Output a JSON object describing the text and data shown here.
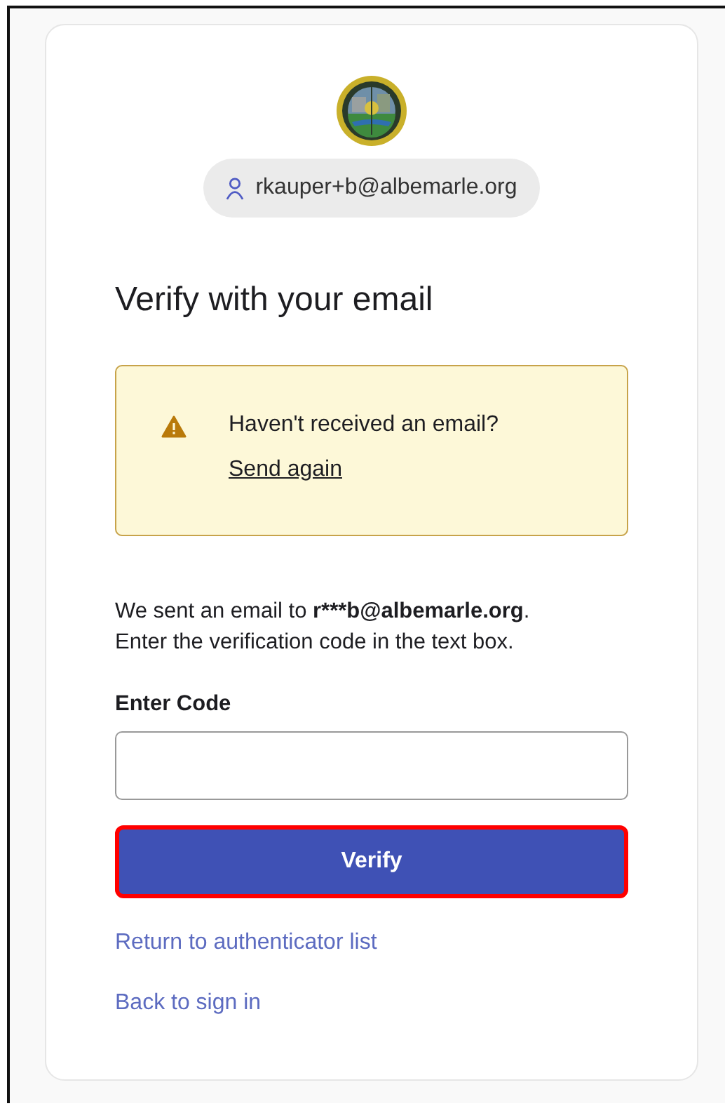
{
  "identity": {
    "email": "rkauper+b@albemarle.org"
  },
  "title": "Verify with your email",
  "alert": {
    "message": "Haven't received an email?",
    "link": "Send again"
  },
  "instructions": {
    "before": "We sent an email to ",
    "email": "r***b@albemarle.org",
    "after": ".\nEnter the verification code in the text box."
  },
  "code_field": {
    "label": "Enter Code"
  },
  "verify_button": {
    "label": "Verify",
    "highlighted": true
  },
  "links": [
    "Return to authenticator list",
    "Back to sign in"
  ]
}
